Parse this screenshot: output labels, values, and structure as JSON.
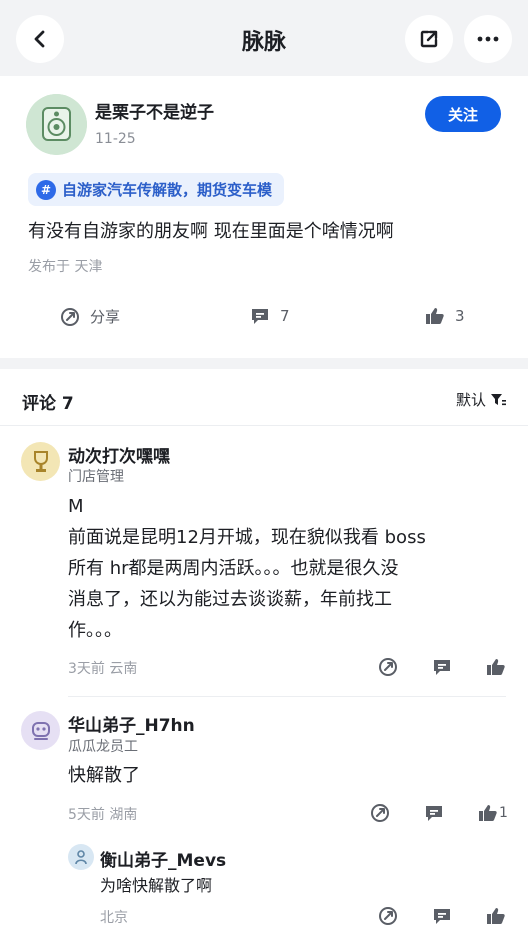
{
  "header": {
    "title": "脉脉"
  },
  "post": {
    "author": "是栗子不是逆子",
    "date": "11-25",
    "follow_label": "关注",
    "topic_tag": "自游家汽车传解散，期货变车模",
    "body": "有没有自游家的朋友啊 现在里面是个啥情况啊",
    "location": "发布于 天津",
    "actions": {
      "share_label": "分享",
      "comment_count": "7",
      "like_count": "3"
    }
  },
  "comments_section": {
    "title": "评论 7",
    "sort_label": "默认",
    "comments": [
      {
        "name": "动次打次嘿嘿",
        "role": "门店管理",
        "lines": [
          "M",
          "前面说是昆明12月开城，现在貌似我看 boss",
          "所有 hr都是两周内活跃。。。也就是很久没",
          "消息了，还以为能过去谈谈薪，年前找工",
          "作。。。"
        ],
        "meta": "3天前  云南"
      },
      {
        "name": "华山弟子_H7hn",
        "role": "瓜瓜龙员工",
        "lines": [
          "快解散了"
        ],
        "meta": "5天前  湖南",
        "like_count": "1",
        "replies": [
          {
            "name": "衡山弟子_Mevs",
            "text": "为啥快解散了啊",
            "meta": "北京"
          }
        ]
      }
    ]
  },
  "colors": {
    "accent": "#1160e6",
    "tag_bg": "#eaf1fd",
    "background": "#f2f3f5"
  },
  "icons": [
    "back-icon",
    "share-out-icon",
    "more-icon",
    "share-icon",
    "comment-icon",
    "like-icon",
    "filter-icon"
  ]
}
